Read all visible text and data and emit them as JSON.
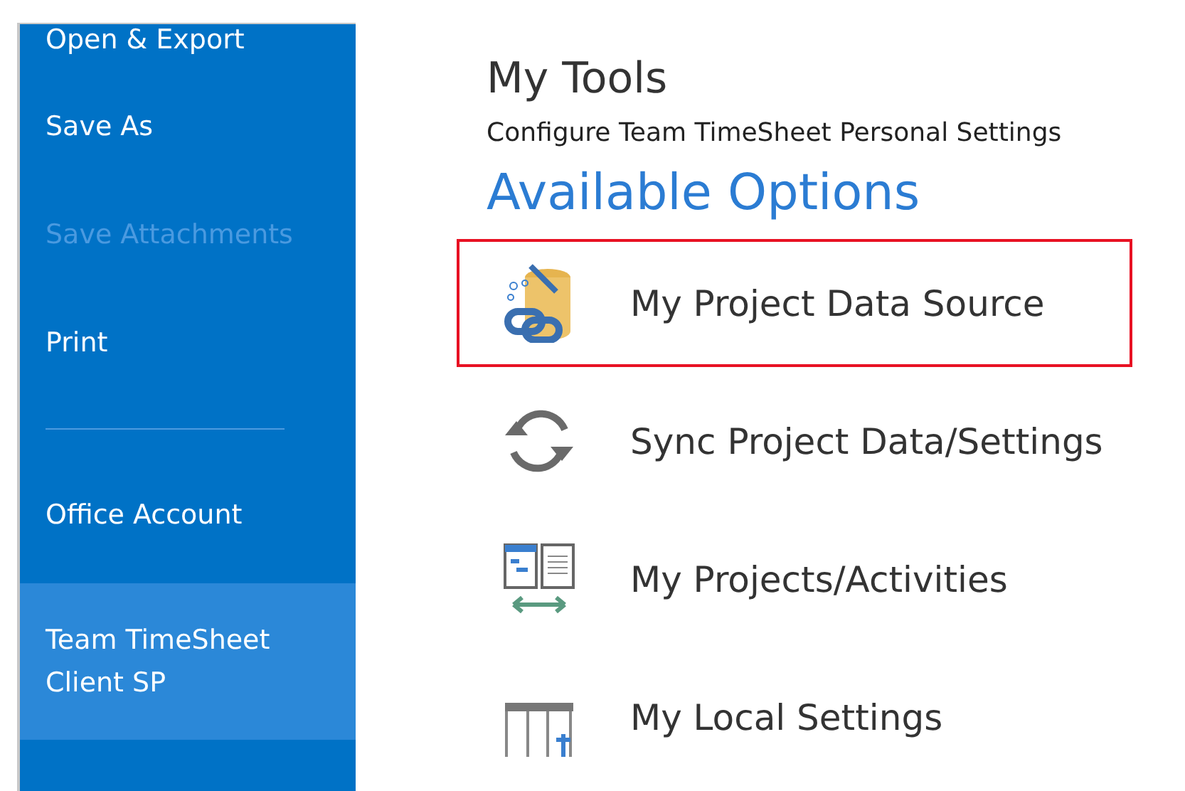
{
  "sidebar": {
    "items": [
      {
        "kind": "item",
        "label": "Open & Export",
        "disabled": false,
        "selected": false
      },
      {
        "kind": "item",
        "label": "Save As",
        "disabled": false,
        "selected": false
      },
      {
        "kind": "item",
        "label": "Save Attachments",
        "disabled": true,
        "selected": false
      },
      {
        "kind": "item",
        "label": "Print",
        "disabled": false,
        "selected": false
      },
      {
        "kind": "divider"
      },
      {
        "kind": "item",
        "label": "Office Account",
        "disabled": false,
        "selected": false
      },
      {
        "kind": "item",
        "label": "Team TimeSheet Client SP",
        "disabled": false,
        "selected": true
      }
    ]
  },
  "main": {
    "title": "My Tools",
    "subtitle": "Configure Team TimeSheet Personal Settings",
    "section": "Available Options",
    "options": [
      {
        "kind": "datasource",
        "label": "My Project Data Source",
        "selected": true
      },
      {
        "kind": "sync",
        "label": "Sync Project Data/Settings",
        "selected": false
      },
      {
        "kind": "projects",
        "label": "My Projects/Activities",
        "selected": false
      },
      {
        "kind": "settings",
        "label": "My Local Settings",
        "selected": false
      }
    ]
  }
}
